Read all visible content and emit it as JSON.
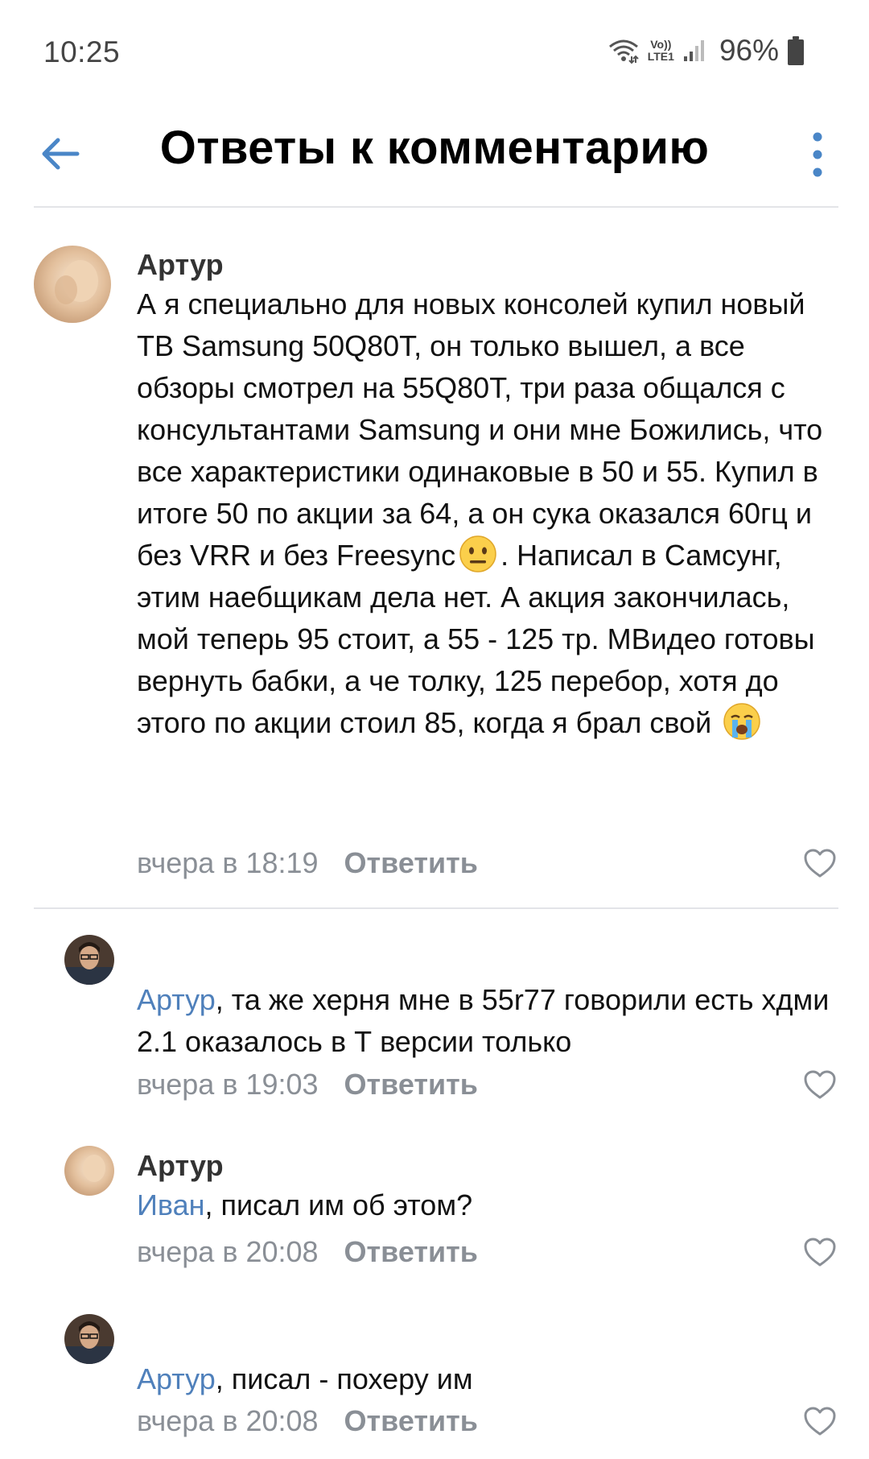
{
  "status_bar": {
    "time": "10:25",
    "network_top": "Vo))",
    "network_bottom": "LTE1",
    "battery": "96%",
    "icons": [
      "wifi-icon",
      "volte-icon",
      "signal-icon",
      "battery-icon"
    ]
  },
  "header": {
    "title": "Ответы к комментарию",
    "back_icon": "arrow-left-icon",
    "more_icon": "more-vertical-icon",
    "accent_color": "#4a86c7"
  },
  "comments": [
    {
      "author": "Артур",
      "mention": "",
      "text_before_emoji": "А я специально для новых консолей купил новый ТВ Samsung 50Q80T, он только вышел, а все обзоры смотрел на 55Q80T, три раза общался с консультантами Samsung и они мне Божились, что все характеристики одинаковые в 50 и 55. Купил в итоге 50 по акции за 64, а он сука оказался 60гц и без VRR и без Freesync",
      "emoji_1": "neutral-face-emoji",
      "text_after_emoji": ". Написал в Самсунг, этим наебщикам дела нет. А акция закончилась, мой теперь 95 стоит, а 55 - 125 тр. МВидео готовы вернуть бабки, а че толку, 125 перебор, хотя до этого по акции стоил 85, когда я брал свой",
      "emoji_2": "crying-face-emoji",
      "time": "вчера в 18:19",
      "reply_label": "Ответить"
    },
    {
      "author": "",
      "mention": "Артур",
      "text": ", та же херня мне в 55r77 говорили есть хдми 2.1 оказалось в Т версии только",
      "time": "вчера в 19:03",
      "reply_label": "Ответить"
    },
    {
      "author": "Артур",
      "mention": "Иван",
      "text": ", писал им об этом?",
      "time": "вчера в 20:08",
      "reply_label": "Ответить"
    },
    {
      "author": "",
      "mention": "Артур",
      "text": ", писал - похеру им",
      "time": "вчера в 20:08",
      "reply_label": "Ответить"
    }
  ],
  "colors": {
    "mention": "#4f80bb",
    "meta": "#8a8f96",
    "divider": "#e3e4e8"
  }
}
